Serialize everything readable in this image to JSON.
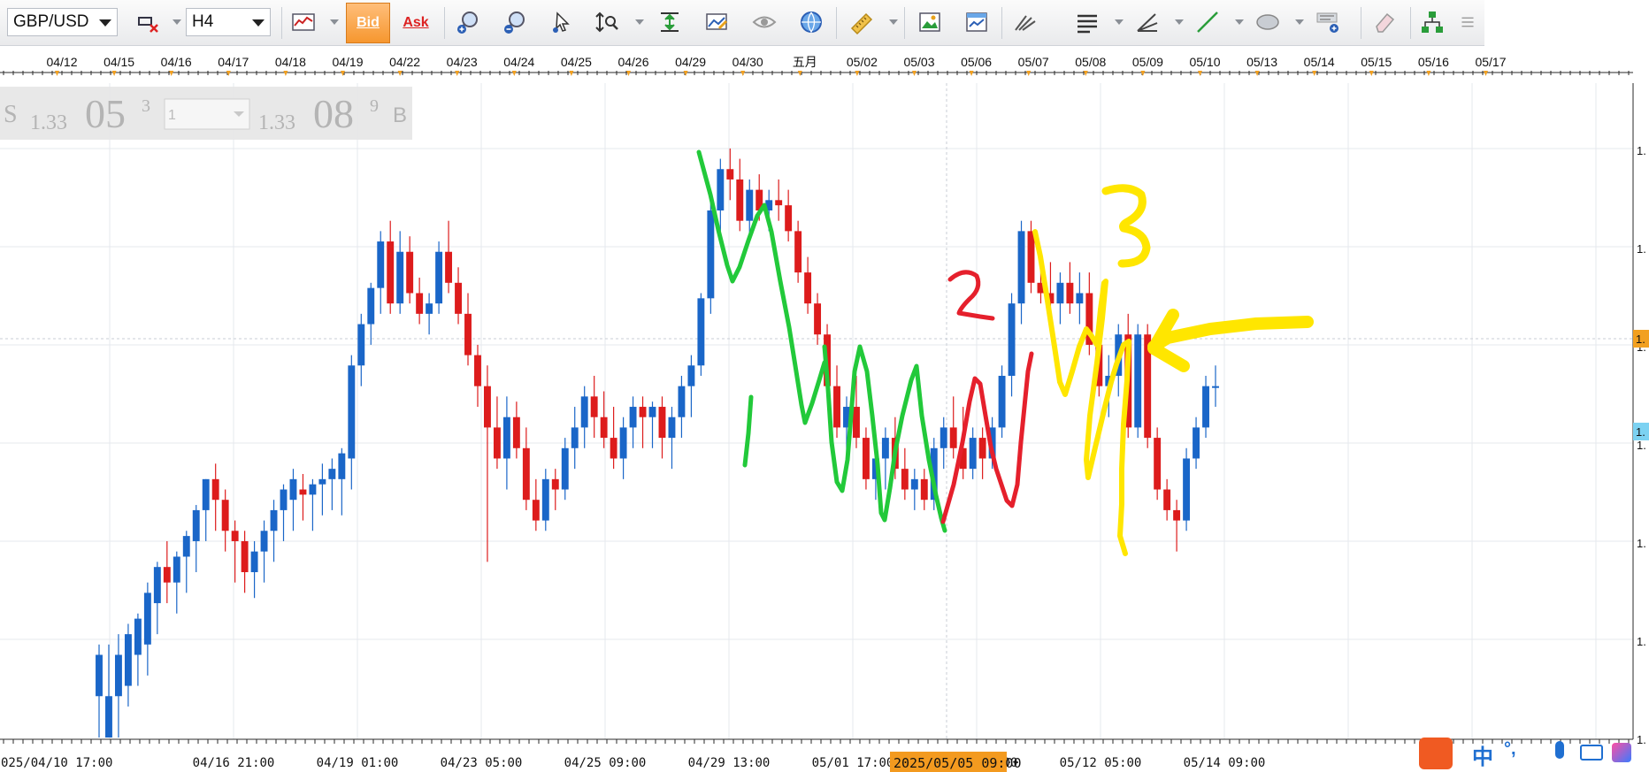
{
  "toolbar": {
    "symbol": "GBP/USD",
    "timeframe": "H4",
    "bid_label": "Bid",
    "ask_label": "Ask",
    "icons": [
      "chart-type-icon",
      "crosshair-cursor-icon",
      "line-chart-icon",
      "zoom-in-icon",
      "zoom-out-icon",
      "pointer-icon",
      "scale-icon",
      "auto-scroll-icon",
      "properties-icon",
      "eye-icon",
      "globe-icon",
      "ruler-icon",
      "image-icon",
      "template-icon",
      "fork-icon",
      "horizontal-lines-icon",
      "angle-icon",
      "trend-line-icon",
      "ellipse-icon",
      "text-icon",
      "eraser-icon",
      "objects-tree-icon",
      "more-icon"
    ]
  },
  "quote_panel": {
    "sell_letter": "S",
    "sell_prefix": "1.33",
    "sell_big": "05",
    "sell_pip": "3",
    "lot_value": "1",
    "buy_prefix": "1.33",
    "buy_big": "08",
    "buy_pip": "9",
    "buy_letter": "B"
  },
  "tray": {
    "ime_text": "中",
    "punct": "°,"
  },
  "chart_data": {
    "type": "candlestick",
    "symbol": "GBP/USD",
    "timeframe": "H4",
    "date_labels": [
      "04/12",
      "04/15",
      "04/16",
      "04/17",
      "04/18",
      "04/19",
      "04/22",
      "04/23",
      "04/24",
      "04/25",
      "04/26",
      "04/29",
      "04/30",
      "五月",
      "05/02",
      "05/03",
      "05/06",
      "05/07",
      "05/08",
      "05/09",
      "05/10",
      "05/13",
      "05/14",
      "05/15",
      "05/16",
      "05/17"
    ],
    "time_labels": [
      "2025/04/10 17:00",
      "04/16 21:00",
      "04/19 01:00",
      "04/23 05:00",
      "04/25 09:00",
      "04/29 13:00",
      "05/01 17:00",
      "05/08 01:00",
      "05/12 05:00",
      "05/14 09:00"
    ],
    "cursor_time_label": "2025/05/05 09:00",
    "price_axis_label": "1.",
    "current_price_marker": "1.",
    "annotations_text": [
      "1",
      "2",
      "3"
    ],
    "annotation_colors": {
      "green": "#22c93a",
      "red": "#e5202c",
      "yellow": "#ffe600"
    },
    "up_color": "#1a66c8",
    "down_color": "#dd1c1c",
    "price_range": [
      0.0,
      1.0
    ],
    "candles": [
      {
        "o": 0.08,
        "h": 0.18,
        "l": 0.0,
        "c": 0.16
      },
      {
        "o": 0.0,
        "h": 0.18,
        "l": 0.0,
        "c": 0.08
      },
      {
        "o": 0.08,
        "h": 0.2,
        "l": 0.0,
        "c": 0.16
      },
      {
        "o": 0.1,
        "h": 0.22,
        "l": 0.06,
        "c": 0.2
      },
      {
        "o": 0.16,
        "h": 0.24,
        "l": 0.1,
        "c": 0.23
      },
      {
        "o": 0.18,
        "h": 0.3,
        "l": 0.12,
        "c": 0.28
      },
      {
        "o": 0.26,
        "h": 0.34,
        "l": 0.2,
        "c": 0.33
      },
      {
        "o": 0.33,
        "h": 0.38,
        "l": 0.26,
        "c": 0.3
      },
      {
        "o": 0.3,
        "h": 0.36,
        "l": 0.24,
        "c": 0.35
      },
      {
        "o": 0.35,
        "h": 0.4,
        "l": 0.28,
        "c": 0.39
      },
      {
        "o": 0.38,
        "h": 0.45,
        "l": 0.32,
        "c": 0.44
      },
      {
        "o": 0.44,
        "h": 0.5,
        "l": 0.38,
        "c": 0.5
      },
      {
        "o": 0.5,
        "h": 0.53,
        "l": 0.4,
        "c": 0.46
      },
      {
        "o": 0.46,
        "h": 0.48,
        "l": 0.36,
        "c": 0.4
      },
      {
        "o": 0.4,
        "h": 0.42,
        "l": 0.3,
        "c": 0.38
      },
      {
        "o": 0.38,
        "h": 0.4,
        "l": 0.28,
        "c": 0.32
      },
      {
        "o": 0.32,
        "h": 0.38,
        "l": 0.27,
        "c": 0.36
      },
      {
        "o": 0.36,
        "h": 0.42,
        "l": 0.3,
        "c": 0.4
      },
      {
        "o": 0.4,
        "h": 0.46,
        "l": 0.34,
        "c": 0.44
      },
      {
        "o": 0.44,
        "h": 0.49,
        "l": 0.38,
        "c": 0.48
      },
      {
        "o": 0.46,
        "h": 0.52,
        "l": 0.4,
        "c": 0.5
      },
      {
        "o": 0.48,
        "h": 0.51,
        "l": 0.42,
        "c": 0.47
      },
      {
        "o": 0.47,
        "h": 0.5,
        "l": 0.4,
        "c": 0.49
      },
      {
        "o": 0.49,
        "h": 0.53,
        "l": 0.43,
        "c": 0.5
      },
      {
        "o": 0.5,
        "h": 0.54,
        "l": 0.44,
        "c": 0.52
      },
      {
        "o": 0.5,
        "h": 0.56,
        "l": 0.43,
        "c": 0.55
      },
      {
        "o": 0.54,
        "h": 0.74,
        "l": 0.48,
        "c": 0.72
      },
      {
        "o": 0.72,
        "h": 0.82,
        "l": 0.68,
        "c": 0.8
      },
      {
        "o": 0.8,
        "h": 0.88,
        "l": 0.76,
        "c": 0.87
      },
      {
        "o": 0.87,
        "h": 0.98,
        "l": 0.82,
        "c": 0.96
      },
      {
        "o": 0.96,
        "h": 1.0,
        "l": 0.82,
        "c": 0.84
      },
      {
        "o": 0.84,
        "h": 0.98,
        "l": 0.82,
        "c": 0.94
      },
      {
        "o": 0.94,
        "h": 0.97,
        "l": 0.84,
        "c": 0.86
      },
      {
        "o": 0.86,
        "h": 0.89,
        "l": 0.8,
        "c": 0.82
      },
      {
        "o": 0.82,
        "h": 0.86,
        "l": 0.78,
        "c": 0.84
      },
      {
        "o": 0.84,
        "h": 0.96,
        "l": 0.82,
        "c": 0.94
      },
      {
        "o": 0.94,
        "h": 1.0,
        "l": 0.86,
        "c": 0.88
      },
      {
        "o": 0.88,
        "h": 0.91,
        "l": 0.8,
        "c": 0.82
      },
      {
        "o": 0.82,
        "h": 0.86,
        "l": 0.72,
        "c": 0.74
      },
      {
        "o": 0.74,
        "h": 0.76,
        "l": 0.64,
        "c": 0.68
      },
      {
        "o": 0.68,
        "h": 0.72,
        "l": 0.34,
        "c": 0.6
      },
      {
        "o": 0.6,
        "h": 0.66,
        "l": 0.52,
        "c": 0.54
      },
      {
        "o": 0.54,
        "h": 0.66,
        "l": 0.48,
        "c": 0.62
      },
      {
        "o": 0.62,
        "h": 0.65,
        "l": 0.54,
        "c": 0.56
      },
      {
        "o": 0.56,
        "h": 0.6,
        "l": 0.44,
        "c": 0.46
      },
      {
        "o": 0.46,
        "h": 0.5,
        "l": 0.4,
        "c": 0.42
      },
      {
        "o": 0.42,
        "h": 0.52,
        "l": 0.4,
        "c": 0.5
      },
      {
        "o": 0.5,
        "h": 0.52,
        "l": 0.44,
        "c": 0.48
      },
      {
        "o": 0.48,
        "h": 0.58,
        "l": 0.46,
        "c": 0.56
      },
      {
        "o": 0.56,
        "h": 0.64,
        "l": 0.52,
        "c": 0.6
      },
      {
        "o": 0.6,
        "h": 0.68,
        "l": 0.56,
        "c": 0.66
      },
      {
        "o": 0.66,
        "h": 0.7,
        "l": 0.58,
        "c": 0.62
      },
      {
        "o": 0.62,
        "h": 0.67,
        "l": 0.56,
        "c": 0.58
      },
      {
        "o": 0.58,
        "h": 0.64,
        "l": 0.52,
        "c": 0.54
      },
      {
        "o": 0.54,
        "h": 0.62,
        "l": 0.5,
        "c": 0.6
      },
      {
        "o": 0.6,
        "h": 0.66,
        "l": 0.56,
        "c": 0.64
      },
      {
        "o": 0.64,
        "h": 0.66,
        "l": 0.56,
        "c": 0.62
      },
      {
        "o": 0.62,
        "h": 0.65,
        "l": 0.56,
        "c": 0.64
      },
      {
        "o": 0.64,
        "h": 0.66,
        "l": 0.54,
        "c": 0.58
      },
      {
        "o": 0.58,
        "h": 0.64,
        "l": 0.52,
        "c": 0.62
      },
      {
        "o": 0.62,
        "h": 0.7,
        "l": 0.58,
        "c": 0.68
      },
      {
        "o": 0.68,
        "h": 0.74,
        "l": 0.62,
        "c": 0.72
      },
      {
        "o": 0.72,
        "h": 0.86,
        "l": 0.7,
        "c": 0.85
      },
      {
        "o": 0.85,
        "h": 1.04,
        "l": 0.82,
        "c": 1.02
      },
      {
        "o": 1.02,
        "h": 1.12,
        "l": 0.98,
        "c": 1.1
      },
      {
        "o": 1.1,
        "h": 1.14,
        "l": 1.04,
        "c": 1.08
      },
      {
        "o": 1.08,
        "h": 1.12,
        "l": 0.98,
        "c": 1.0
      },
      {
        "o": 1.0,
        "h": 1.08,
        "l": 0.96,
        "c": 1.06
      },
      {
        "o": 1.06,
        "h": 1.09,
        "l": 1.0,
        "c": 1.02
      },
      {
        "o": 1.02,
        "h": 1.06,
        "l": 0.98,
        "c": 1.04
      },
      {
        "o": 1.04,
        "h": 1.08,
        "l": 1.0,
        "c": 1.03
      },
      {
        "o": 1.03,
        "h": 1.06,
        "l": 0.96,
        "c": 0.98
      },
      {
        "o": 0.98,
        "h": 1.0,
        "l": 0.88,
        "c": 0.9
      },
      {
        "o": 0.9,
        "h": 0.93,
        "l": 0.82,
        "c": 0.84
      },
      {
        "o": 0.84,
        "h": 0.86,
        "l": 0.76,
        "c": 0.78
      },
      {
        "o": 0.78,
        "h": 0.8,
        "l": 0.66,
        "c": 0.68
      },
      {
        "o": 0.68,
        "h": 0.72,
        "l": 0.58,
        "c": 0.6
      },
      {
        "o": 0.6,
        "h": 0.66,
        "l": 0.52,
        "c": 0.64
      },
      {
        "o": 0.64,
        "h": 0.7,
        "l": 0.56,
        "c": 0.58
      },
      {
        "o": 0.58,
        "h": 0.6,
        "l": 0.48,
        "c": 0.5
      },
      {
        "o": 0.5,
        "h": 0.56,
        "l": 0.46,
        "c": 0.54
      },
      {
        "o": 0.54,
        "h": 0.6,
        "l": 0.48,
        "c": 0.58
      },
      {
        "o": 0.58,
        "h": 0.62,
        "l": 0.5,
        "c": 0.52
      },
      {
        "o": 0.52,
        "h": 0.56,
        "l": 0.46,
        "c": 0.48
      },
      {
        "o": 0.48,
        "h": 0.52,
        "l": 0.44,
        "c": 0.5
      },
      {
        "o": 0.5,
        "h": 0.52,
        "l": 0.44,
        "c": 0.46
      },
      {
        "o": 0.46,
        "h": 0.58,
        "l": 0.44,
        "c": 0.56
      },
      {
        "o": 0.56,
        "h": 0.62,
        "l": 0.52,
        "c": 0.6
      },
      {
        "o": 0.6,
        "h": 0.66,
        "l": 0.54,
        "c": 0.56
      },
      {
        "o": 0.56,
        "h": 0.64,
        "l": 0.5,
        "c": 0.52
      },
      {
        "o": 0.52,
        "h": 0.6,
        "l": 0.5,
        "c": 0.58
      },
      {
        "o": 0.58,
        "h": 0.6,
        "l": 0.5,
        "c": 0.54
      },
      {
        "o": 0.54,
        "h": 0.62,
        "l": 0.52,
        "c": 0.6
      },
      {
        "o": 0.6,
        "h": 0.72,
        "l": 0.58,
        "c": 0.7
      },
      {
        "o": 0.7,
        "h": 0.86,
        "l": 0.66,
        "c": 0.84
      },
      {
        "o": 0.84,
        "h": 1.0,
        "l": 0.8,
        "c": 0.98
      },
      {
        "o": 0.98,
        "h": 1.0,
        "l": 0.86,
        "c": 0.88
      },
      {
        "o": 0.88,
        "h": 0.92,
        "l": 0.84,
        "c": 0.86
      },
      {
        "o": 0.86,
        "h": 0.92,
        "l": 0.82,
        "c": 0.84
      },
      {
        "o": 0.84,
        "h": 0.9,
        "l": 0.8,
        "c": 0.88
      },
      {
        "o": 0.88,
        "h": 0.92,
        "l": 0.82,
        "c": 0.84
      },
      {
        "o": 0.84,
        "h": 0.9,
        "l": 0.8,
        "c": 0.86
      },
      {
        "o": 0.86,
        "h": 0.9,
        "l": 0.74,
        "c": 0.76
      },
      {
        "o": 0.76,
        "h": 0.8,
        "l": 0.66,
        "c": 0.68
      },
      {
        "o": 0.68,
        "h": 0.74,
        "l": 0.62,
        "c": 0.7
      },
      {
        "o": 0.7,
        "h": 0.8,
        "l": 0.66,
        "c": 0.78
      },
      {
        "o": 0.78,
        "h": 0.82,
        "l": 0.58,
        "c": 0.6
      },
      {
        "o": 0.6,
        "h": 0.8,
        "l": 0.58,
        "c": 0.78
      },
      {
        "o": 0.78,
        "h": 0.8,
        "l": 0.56,
        "c": 0.58
      },
      {
        "o": 0.58,
        "h": 0.6,
        "l": 0.46,
        "c": 0.48
      },
      {
        "o": 0.48,
        "h": 0.5,
        "l": 0.42,
        "c": 0.44
      },
      {
        "o": 0.44,
        "h": 0.46,
        "l": 0.36,
        "c": 0.42
      },
      {
        "o": 0.42,
        "h": 0.56,
        "l": 0.4,
        "c": 0.54
      },
      {
        "o": 0.54,
        "h": 0.62,
        "l": 0.52,
        "c": 0.6
      },
      {
        "o": 0.6,
        "h": 0.7,
        "l": 0.58,
        "c": 0.68
      },
      {
        "o": 0.68,
        "h": 0.72,
        "l": 0.64,
        "c": 0.68
      }
    ]
  }
}
